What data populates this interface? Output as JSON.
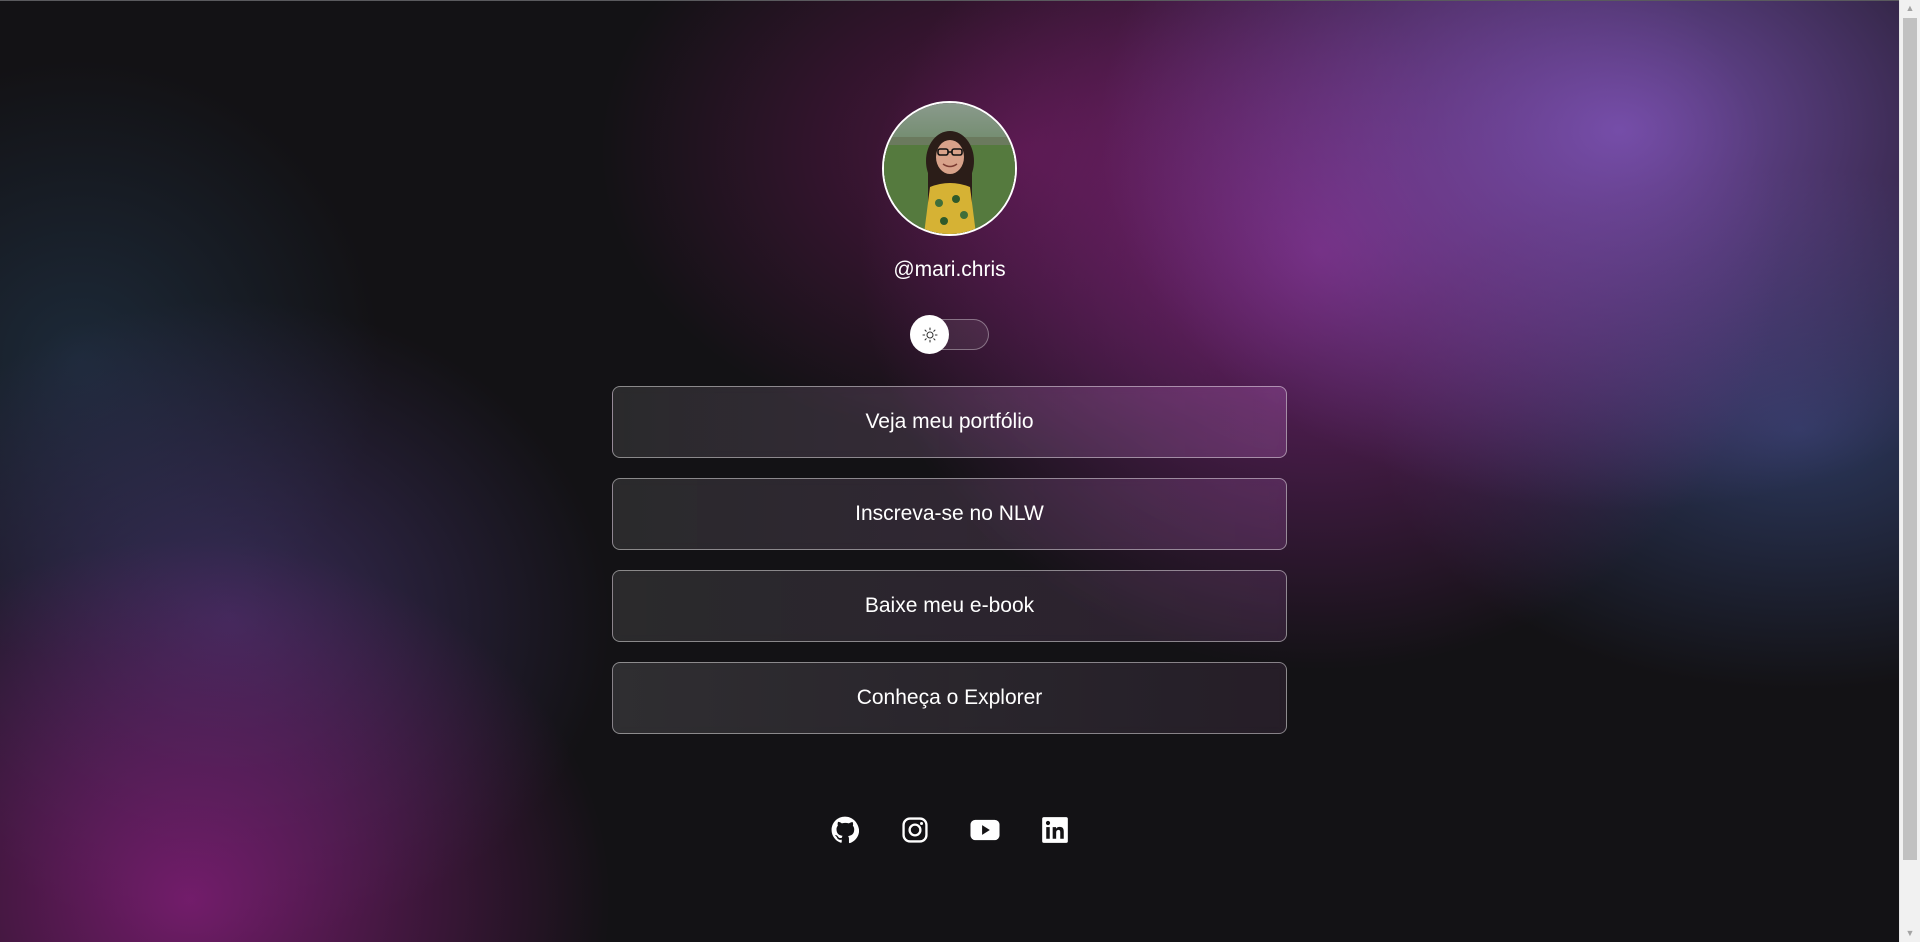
{
  "profile": {
    "username": "@mari.chris",
    "avatar_alt": "Foto de perfil"
  },
  "theme_switch": {
    "icon": "sun-icon",
    "state": "dark"
  },
  "links": [
    {
      "label": "Veja meu portfólio"
    },
    {
      "label": "Inscreva-se no NLW"
    },
    {
      "label": "Baixe meu e-book"
    },
    {
      "label": "Conheça o Explorer"
    }
  ],
  "social": [
    {
      "icon": "github-icon"
    },
    {
      "icon": "instagram-icon"
    },
    {
      "icon": "youtube-icon"
    },
    {
      "icon": "linkedin-icon"
    }
  ],
  "colors": {
    "background": "#121214",
    "accent_purple": "#8257e5",
    "text": "#ffffff"
  }
}
